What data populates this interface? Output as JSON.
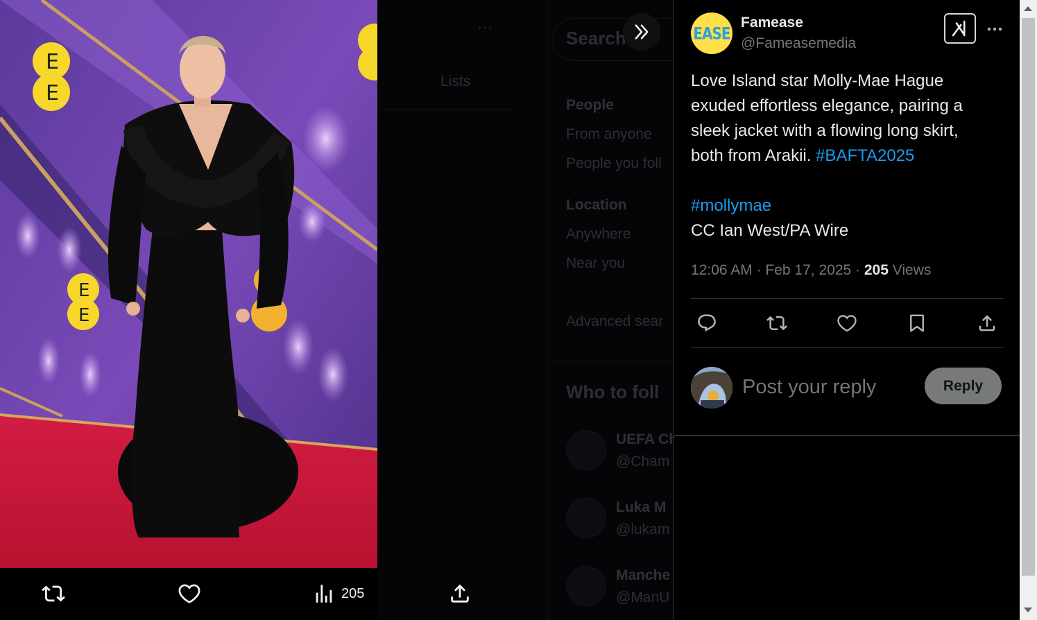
{
  "background_page": {
    "search_title": "Search filt",
    "tab_lists": "Lists",
    "people_heading": "People",
    "from_anyone": "From anyone",
    "people_you_follow": "People you foll",
    "location_heading": "Location",
    "anywhere": "Anywhere",
    "near_you": "Near you",
    "advanced_search": "Advanced sear",
    "who_to_follow": "Who to foll",
    "suggestions": [
      {
        "name": "UEFA Ch",
        "handle": "@Cham"
      },
      {
        "name": "Luka M",
        "handle": "@lukam"
      },
      {
        "name": "Manche",
        "handle": "@ManU"
      }
    ],
    "views_ghost": "205"
  },
  "media_bar": {
    "views_count": "205"
  },
  "tweet": {
    "author_name": "Famease",
    "author_handle": "@Fameasemedia",
    "avatar_text": "EASE",
    "text_lines": [
      "Love Island star Molly-Mae Hague",
      "exuded effortless elegance, pairing a",
      "sleek jacket with a flowing long skirt,",
      "both from Arakii."
    ],
    "hashtag_inline": "#BAFTA2025",
    "hashtag_2": "#mollymae",
    "credit": "CC Ian West/PA Wire",
    "time": "12:06 AM",
    "date": "Feb 17, 2025",
    "views_count": "205",
    "views_label": "Views"
  },
  "reply": {
    "placeholder": "Post your reply",
    "button_label": "Reply"
  },
  "colors": {
    "accent": "#1d9bf0",
    "muted": "#71767b",
    "text": "#e7e9ea",
    "carpet": "#c81a3c",
    "backdrop": "#6a3fa8",
    "ee_yellow": "#f7d82a"
  }
}
